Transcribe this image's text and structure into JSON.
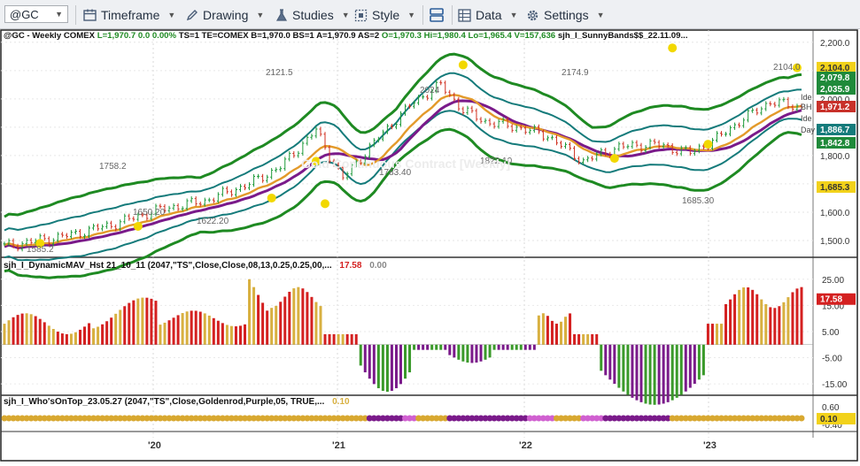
{
  "toolbar": {
    "symbol": "@GC",
    "timeframe": "Timeframe",
    "drawing": "Drawing",
    "studies": "Studies",
    "style": "Style",
    "data": "Data",
    "settings": "Settings"
  },
  "price_panel": {
    "header_symbol": "@GC - Weekly",
    "header_exchange": "COMEX",
    "header_stats": "L=1,970.7  0.0  0.00%",
    "header_ts": "TS=1  TE=COMEX  B=1,970.0  BS=1  A=1,970.9  AS=2",
    "header_ohlc": "O=1,970.3  Hi=1,980.4  Lo=1,965.4  V=157,636",
    "header_study": "sjh_I_SunnyBands$$_22.11.09...",
    "watermark": "Gold Continuous Contract [Weekly]",
    "axis_ticks": [
      "2,200.0",
      "2,100.0",
      "2,000.0",
      "1,900.0",
      "1,800.0",
      "1,700.0",
      "1,600.0",
      "1,500.0"
    ],
    "price_tags": [
      {
        "label": "2,104.0",
        "color": "#f2d21b",
        "text_color": "#333333"
      },
      {
        "label": "2,079.8",
        "color": "#1f8a3a",
        "text_color": "#ffffff"
      },
      {
        "label": "2,035.9",
        "color": "#1f8a3a",
        "text_color": "#ffffff"
      },
      {
        "label": "1,971.2",
        "color": "#c8312a",
        "text_color": "#ffffff"
      },
      {
        "label": "1,886.7",
        "color": "#157b7b",
        "text_color": "#ffffff"
      },
      {
        "label": "1,842.8",
        "color": "#1f8a3a",
        "text_color": "#ffffff"
      },
      {
        "label": "1,685.3",
        "color": "#f2d21b",
        "text_color": "#333333"
      }
    ],
    "side_labels": [
      "Ide",
      "BH",
      "Ide",
      "Day"
    ],
    "annotations": [
      "2121.5",
      "2174.9",
      "2104.0",
      "1783.40",
      "1822.10",
      "1622.20",
      "1650.20",
      "1685.30",
      "2024",
      "1758.2",
      "1585.2"
    ]
  },
  "indicator1": {
    "title": "sjh_I_DynamicMAV_Hst 21_10_11 (2047,\"TS\",Close,Close,08,13,0.25,0.25,00,...",
    "value_red": "17.58",
    "value_gray": "0.00",
    "axis_ticks": [
      "25.00",
      "15.00",
      "5.00",
      "-5.00",
      "-15.00"
    ],
    "tag": "17.58"
  },
  "indicator2": {
    "title": "sjh_I_Who'sOnTop_23.05.27 (2047,\"TS\",Close,Goldenrod,Purple,05,  TRUE,...",
    "value": "0.10",
    "axis_ticks": [
      "0.60",
      "-0.40"
    ],
    "tag": "0.10"
  },
  "time_axis": {
    "labels": [
      "'20",
      "'21",
      "'22",
      "'23"
    ]
  },
  "colors": {
    "band_outer": "#1e8a22",
    "band_inner": "#157b7b",
    "ma_orange": "#e39a2a",
    "ma_purple": "#7a1a8a",
    "bar_up": "#1e9a3a",
    "bar_down": "#d03020",
    "hist_red": "#d42020",
    "hist_gold": "#d8b040",
    "hist_green": "#3a9a2a",
    "hist_purple": "#7a1a8a",
    "dot_gold": "#d8a830",
    "dot_purple": "#7a1a8a",
    "dot_pink": "#d060d0",
    "marker_yellow": "#f2d800"
  }
}
